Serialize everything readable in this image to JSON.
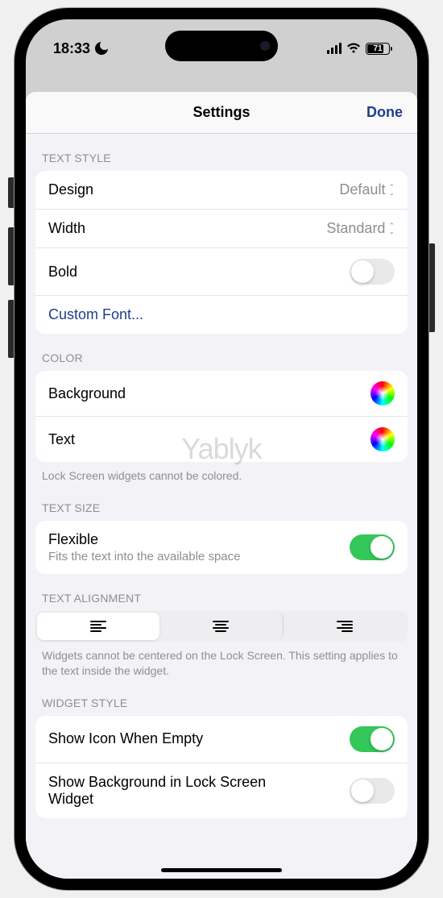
{
  "status": {
    "time": "18:33",
    "battery": "71"
  },
  "header": {
    "title": "Settings",
    "done": "Done"
  },
  "sections": {
    "text_style": {
      "header": "TEXT STYLE",
      "design_label": "Design",
      "design_value": "Default",
      "width_label": "Width",
      "width_value": "Standard",
      "bold_label": "Bold",
      "custom_font": "Custom Font..."
    },
    "color": {
      "header": "COLOR",
      "background_label": "Background",
      "text_label": "Text",
      "footer": "Lock Screen widgets cannot be colored."
    },
    "text_size": {
      "header": "TEXT SIZE",
      "flexible_label": "Flexible",
      "flexible_sub": "Fits the text into the available space"
    },
    "alignment": {
      "header": "TEXT ALIGNMENT",
      "footer": "Widgets cannot be centered on the Lock Screen. This setting applies to the text inside the widget."
    },
    "widget_style": {
      "header": "WIDGET STYLE",
      "show_icon_label": "Show Icon When Empty",
      "show_bg_label": "Show Background in Lock Screen Widget"
    }
  },
  "watermark": "Yablyk"
}
